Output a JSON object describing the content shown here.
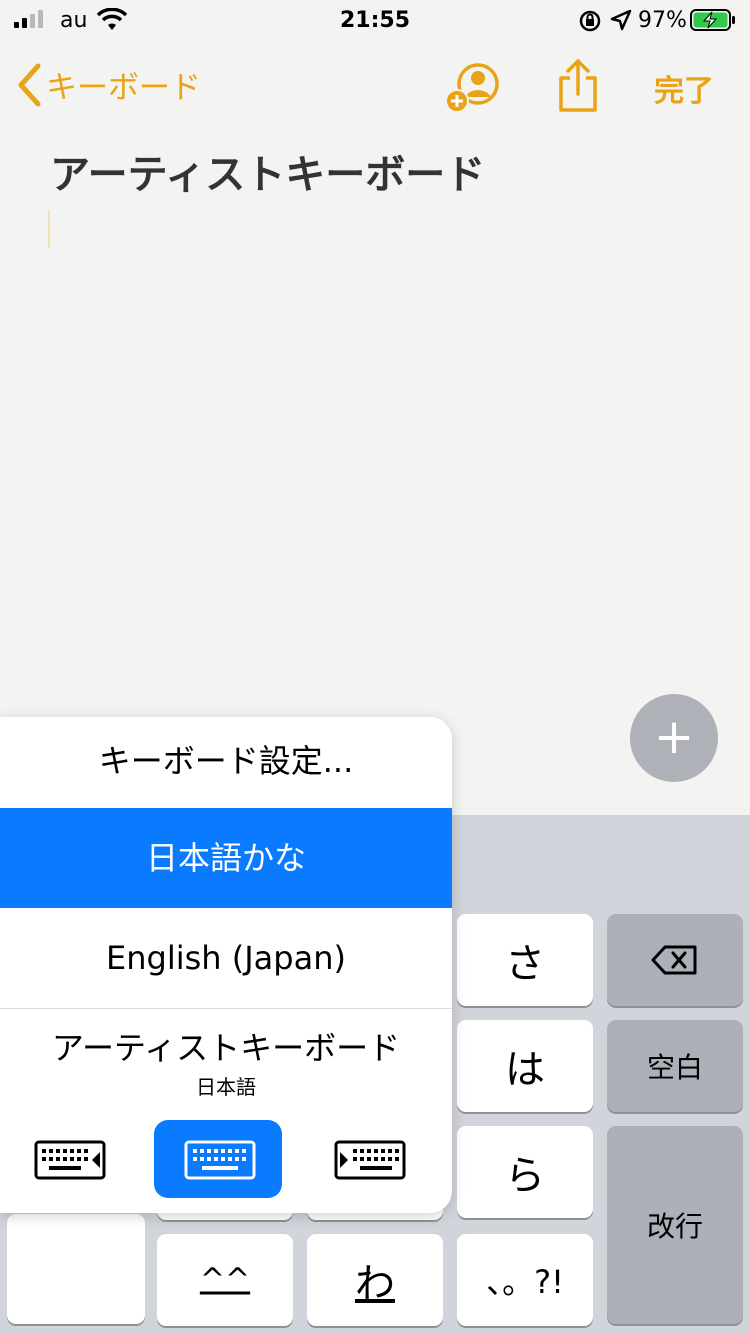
{
  "status_bar": {
    "carrier": "au",
    "time": "21:55",
    "battery_percent": "97%",
    "signal_bars": 2,
    "icons": [
      "signal-icon",
      "wifi-icon",
      "orientation-lock-icon",
      "location-icon",
      "battery-charging-icon"
    ]
  },
  "nav": {
    "back_label": "キーボード",
    "done_label": "完了",
    "icons": [
      "chevron-left-icon",
      "add-person-icon",
      "share-icon"
    ]
  },
  "note": {
    "title": "アーティストキーボード"
  },
  "fab": {
    "label": "+"
  },
  "keyboard_menu": {
    "settings_label": "キーボード設定...",
    "items": [
      {
        "label": "日本語かな",
        "selected": true
      },
      {
        "label": "English (Japan)",
        "selected": false
      },
      {
        "label": "アーティストキーボード",
        "sub": "日本語",
        "selected": false
      }
    ],
    "layout_buttons": [
      {
        "icon": "keyboard-left-icon",
        "selected": false
      },
      {
        "icon": "keyboard-full-icon",
        "selected": true
      },
      {
        "icon": "keyboard-right-icon",
        "selected": false
      }
    ]
  },
  "keyboard": {
    "keys": {
      "sa": "さ",
      "ha": "は",
      "ra": "ら",
      "wa": "わ",
      "emoticon": "^^",
      "punct": "、。?!",
      "space": "空白",
      "return": "改行"
    },
    "colors": {
      "accent": "#e8a317",
      "selection": "#0a7aff",
      "keyboard_bg": "#d1d4da"
    }
  }
}
